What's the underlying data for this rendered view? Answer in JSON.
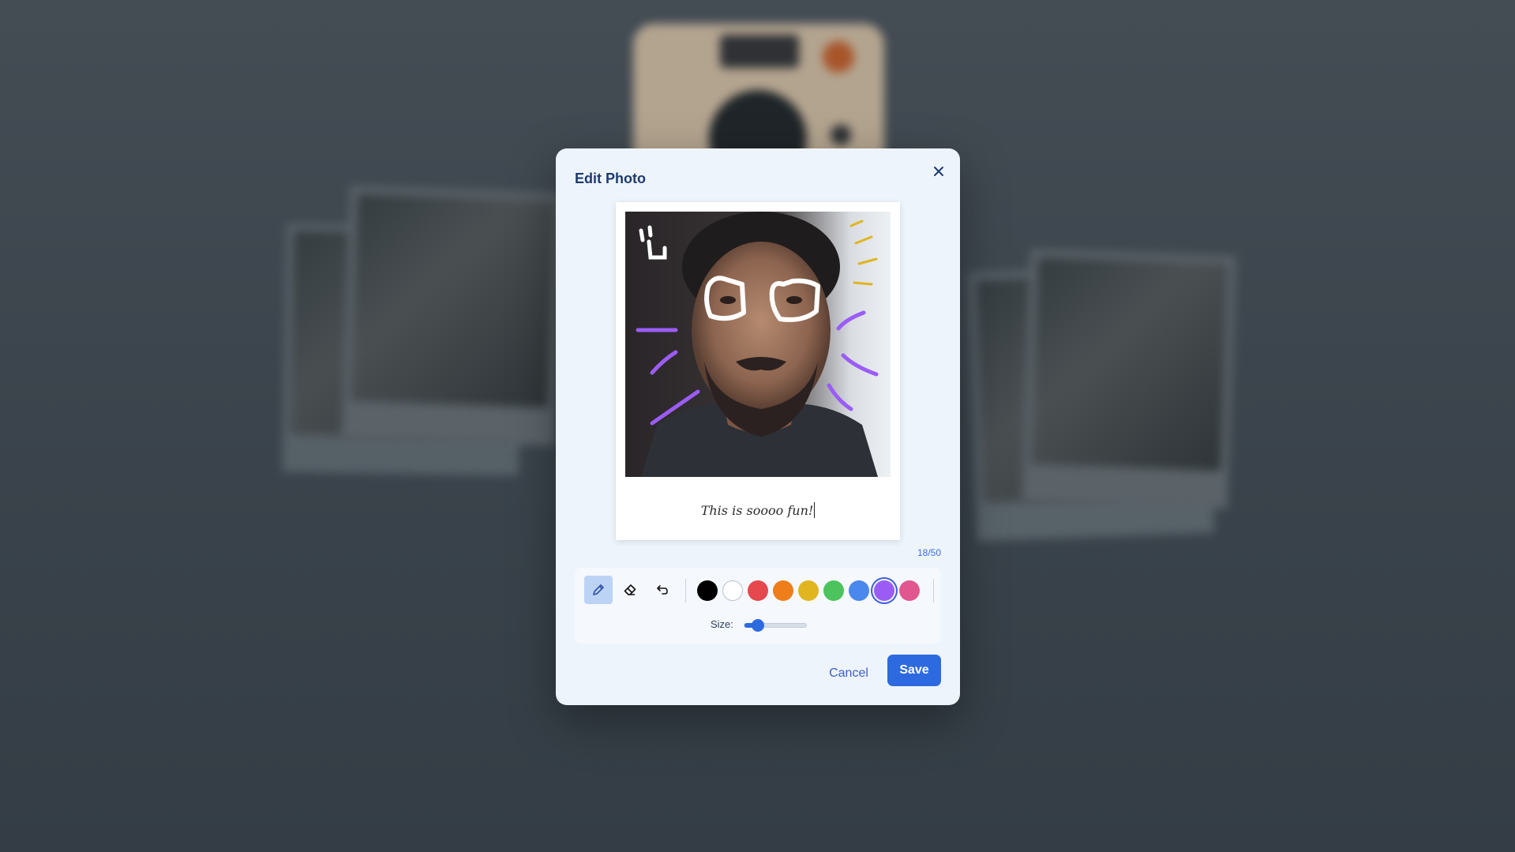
{
  "dialog": {
    "title": "Edit Photo",
    "close_icon": "close-icon"
  },
  "photo": {
    "caption": "This is soooo fun!",
    "char_count": "18/50"
  },
  "toolbar": {
    "tools": [
      {
        "name": "pencil-icon",
        "active": true
      },
      {
        "name": "eraser-icon",
        "active": false
      },
      {
        "name": "undo-icon",
        "active": false
      }
    ],
    "colors": [
      {
        "name": "black",
        "hex": "#000000",
        "selected": false
      },
      {
        "name": "white",
        "hex": "#ffffff",
        "selected": false
      },
      {
        "name": "red",
        "hex": "#e5484d",
        "selected": false
      },
      {
        "name": "orange",
        "hex": "#ef7d1a",
        "selected": false
      },
      {
        "name": "yellow",
        "hex": "#e0b51f",
        "selected": false
      },
      {
        "name": "green",
        "hex": "#4cc35c",
        "selected": false
      },
      {
        "name": "blue",
        "hex": "#4a88ee",
        "selected": false
      },
      {
        "name": "purple",
        "hex": "#9b5cf6",
        "selected": true
      },
      {
        "name": "pink",
        "hex": "#e2568f",
        "selected": false
      }
    ],
    "size_label": "Size:",
    "size_value": 0.22
  },
  "actions": {
    "cancel_label": "Cancel",
    "save_label": "Save"
  },
  "colors": {
    "accent": "#2d6ae0",
    "title": "#1e3a6e",
    "modal_bg": "#eef4fc"
  }
}
